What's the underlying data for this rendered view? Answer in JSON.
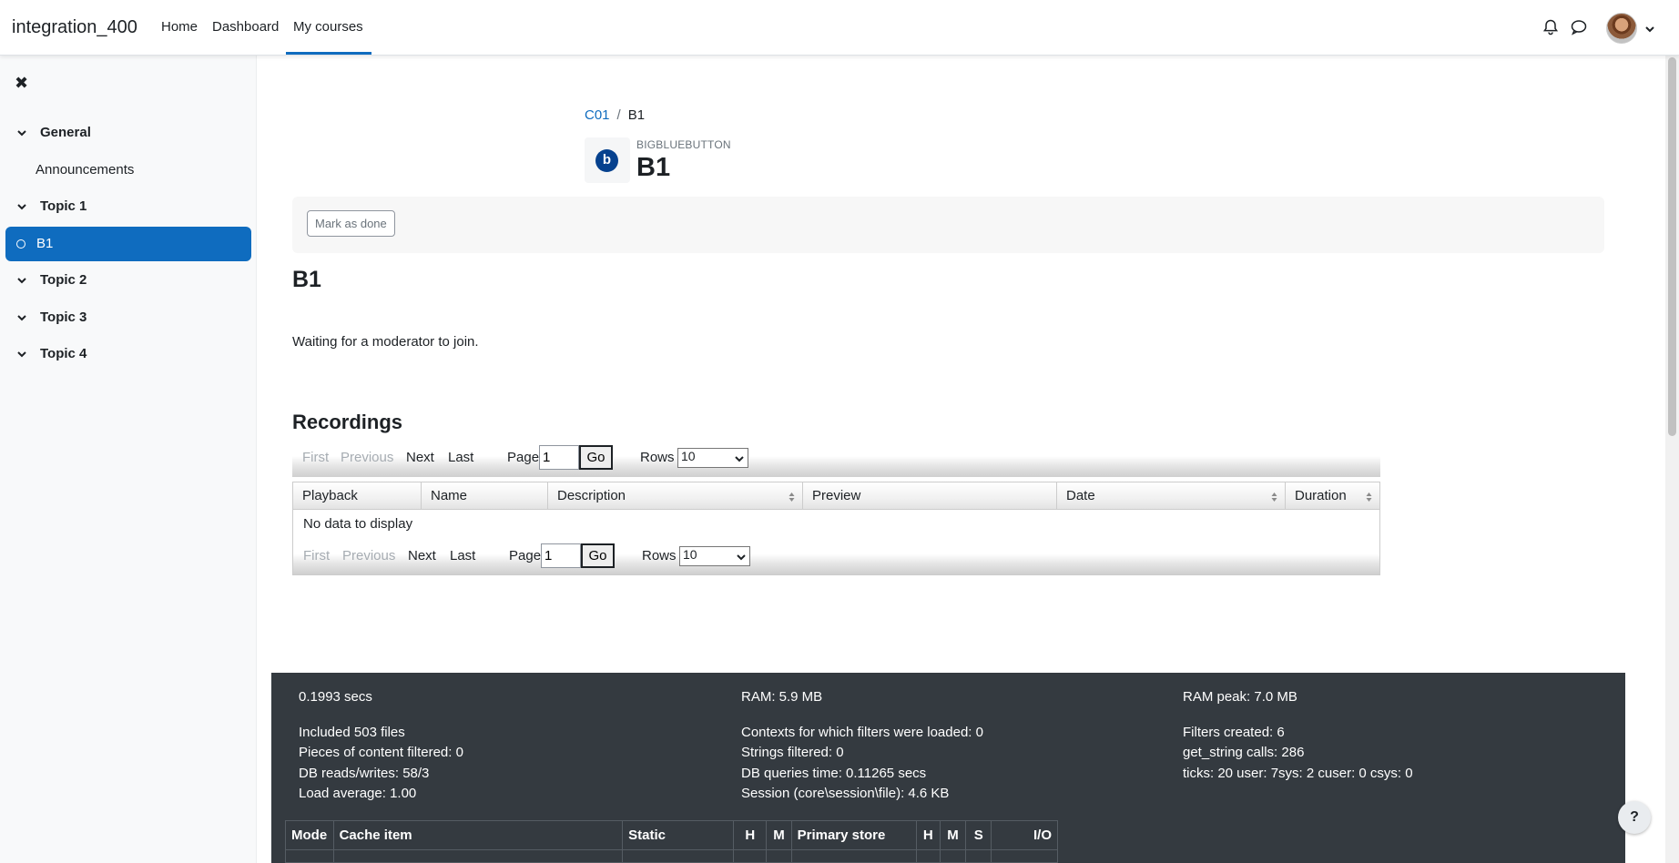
{
  "navbar": {
    "brand": "integration_400",
    "links": [
      "Home",
      "Dashboard",
      "My courses"
    ],
    "active": "My courses"
  },
  "drawer": {
    "close_glyph": "✖",
    "sections": [
      {
        "label": "General"
      },
      {
        "label": "Topic 1"
      },
      {
        "label": "Topic 2"
      },
      {
        "label": "Topic 3"
      },
      {
        "label": "Topic 4"
      }
    ],
    "items": [
      {
        "label": "Announcements"
      },
      {
        "label": "B1",
        "active": true
      }
    ]
  },
  "breadcrumb": {
    "course": "C01",
    "separator": "/",
    "current": "B1"
  },
  "module": {
    "type": "BIGBLUEBUTTON",
    "title": "B1",
    "icon_glyph": "b"
  },
  "completion": {
    "button": "Mark as done"
  },
  "activity": {
    "heading": "B1",
    "status": "Waiting for a moderator to join."
  },
  "recordings": {
    "heading": "Recordings",
    "paginator": {
      "first": "First",
      "previous": "Previous",
      "next": "Next",
      "last": "Last",
      "page_label": "Page",
      "page_value": "1",
      "go": "Go",
      "rows_label": "Rows",
      "rows_value": "10"
    },
    "columns": [
      "Playback",
      "Name",
      "Description",
      "Preview",
      "Date",
      "Duration"
    ],
    "empty": "No data to display"
  },
  "performance": {
    "col1": [
      "0.1993 secs",
      "Included 503 files",
      "Pieces of content filtered: 0",
      "DB reads/writes: 58/3",
      "Load average: 1.00"
    ],
    "col2": [
      "RAM: 5.9 MB",
      "Contexts for which filters were loaded: 0",
      "Strings filtered: 0",
      "DB queries time: 0.11265 secs",
      "Session (core\\session\\file): 4.6 KB"
    ],
    "col3": [
      "RAM peak: 7.0 MB",
      "Filters created: 6",
      "get_string calls: 286",
      "ticks: 20 user: 7sys: 2 cuser: 0 csys: 0"
    ],
    "cache_columns": [
      "Mode",
      "Cache item",
      "Static",
      "H",
      "M",
      "Primary store",
      "H",
      "M",
      "S",
      "I/O"
    ]
  },
  "help": {
    "label": "?"
  },
  "colors": {
    "primary": "#0f6cbf",
    "footer": "#343a40",
    "bbb": "#06418e"
  }
}
